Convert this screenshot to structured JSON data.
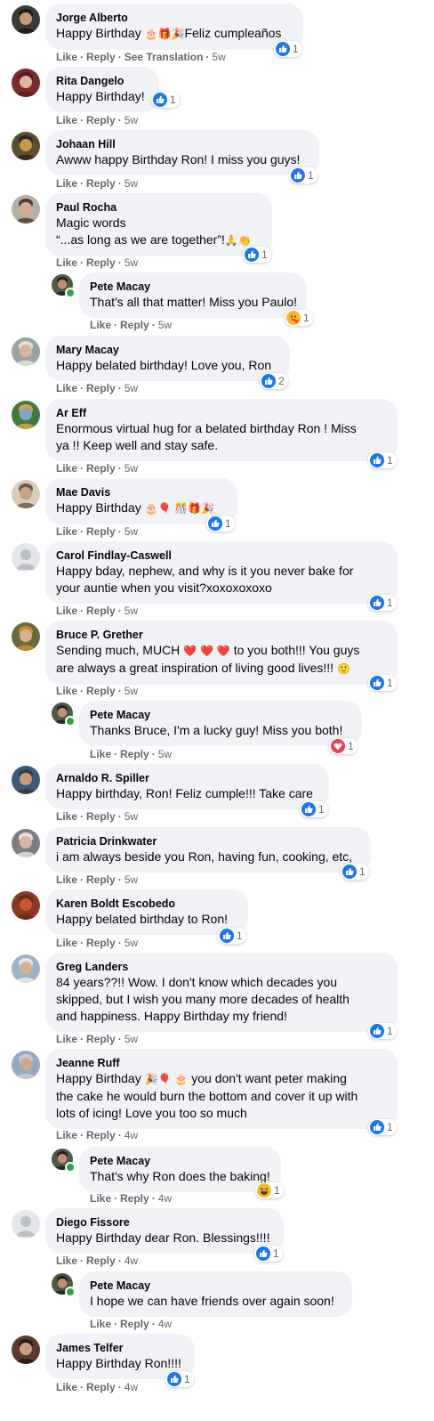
{
  "colors": {
    "like_blue": "#1877f2",
    "love_red": "#f33e58",
    "haha_yellow": "#f7b928",
    "bubble_bg": "#f0f2f5",
    "meta_gray": "#65676b"
  },
  "actions": {
    "like": "Like",
    "reply": "Reply",
    "see_translation": "See Translation",
    "sep": "·"
  },
  "comments": [
    {
      "author": "Jorge Alberto",
      "lines": [
        "Happy Birthday 🎂🎁🎉Feliz cumpleaños"
      ],
      "time": "5w",
      "translation": true,
      "reaction": {
        "icon": "like-icon",
        "count": "1"
      },
      "reply": false,
      "avatar": "avatar-jorge"
    },
    {
      "author": "Rita Dangelo",
      "lines": [
        "Happy Birthday!"
      ],
      "time": "5w",
      "reaction": {
        "icon": "like-icon",
        "count": "1"
      },
      "reply": false
    },
    {
      "author": "Johaan Hill",
      "lines": [
        "Awww happy Birthday Ron! I miss you guys!"
      ],
      "time": "5w",
      "reaction": {
        "icon": "like-icon",
        "count": "1"
      },
      "reply": false
    },
    {
      "author": "Paul Rocha",
      "lines": [
        "Magic words",
        "“...as long as we are together”!🙏👏"
      ],
      "time": "5w",
      "reaction": {
        "icon": "like-icon",
        "count": "1"
      },
      "reply": false
    },
    {
      "author": "Pete Macay",
      "lines": [
        "That's all that matter! Miss you Paulo!"
      ],
      "time": "5w",
      "reaction": {
        "icon": "care-icon",
        "count": "1"
      },
      "reply": true
    },
    {
      "author": "Mary Macay",
      "lines": [
        "Happy belated birthday! Love you, Ron"
      ],
      "time": "5w",
      "reaction": {
        "icon": "like-icon",
        "count": "2"
      },
      "reply": false
    },
    {
      "author": "Ar Eff",
      "lines": [
        "Enormous virtual hug for a belated birthday Ron ! Miss",
        "ya !! Keep well and stay safe."
      ],
      "time": "5w",
      "reaction": {
        "icon": "like-icon",
        "count": "1"
      },
      "reply": false
    },
    {
      "author": "Mae Davis",
      "lines": [
        "Happy Birthday 🎂🎈 🎊🎁🎉"
      ],
      "time": "5w",
      "reaction": {
        "icon": "like-icon",
        "count": "1"
      },
      "reply": false
    },
    {
      "author": "Carol Findlay-Caswell",
      "lines": [
        "Happy bday, nephew, and why is it you never bake for",
        "your auntie when you visit?xoxoxoxoxo"
      ],
      "time": "5w",
      "reaction": {
        "icon": "like-icon",
        "count": "1"
      },
      "reply": false
    },
    {
      "author": "Bruce P. Grether",
      "lines": [
        "Sending much, MUCH ❤️ ❤️ ❤️ to you both!!! You guys",
        "are always a great inspiration of living good lives!!! 🙂"
      ],
      "time": "5w",
      "reaction": {
        "icon": "like-icon",
        "count": "1"
      },
      "reply": false
    },
    {
      "author": "Pete Macay",
      "lines": [
        "Thanks Bruce, I'm a lucky guy! Miss you both!"
      ],
      "time": "5w",
      "reaction": {
        "icon": "love-icon",
        "count": "1"
      },
      "reply": true
    },
    {
      "author": "Arnaldo R. Spiller",
      "lines": [
        "Happy birthday, Ron! Feliz cumple!!! Take care"
      ],
      "time": "5w",
      "reaction": {
        "icon": "like-icon",
        "count": "1"
      },
      "reply": false
    },
    {
      "author": "Patricia Drinkwater",
      "lines": [
        "i am always beside you Ron, having fun, cooking, etc,"
      ],
      "time": "5w",
      "reaction": {
        "icon": "like-icon",
        "count": "1"
      },
      "reply": false
    },
    {
      "author": "Karen Boldt Escobedo",
      "lines": [
        "Happy belated birthday to Ron!"
      ],
      "time": "5w",
      "reaction": {
        "icon": "like-icon",
        "count": "1"
      },
      "reply": false
    },
    {
      "author": "Greg Landers",
      "lines": [
        "84 years??!! Wow. I don't know which decades you",
        "skipped, but I wish you many more decades of health",
        "and happiness. Happy Birthday my friend!"
      ],
      "time": "5w",
      "reaction": {
        "icon": "like-icon",
        "count": "1"
      },
      "reply": false
    },
    {
      "author": "Jeanne Ruff",
      "lines": [
        "Happy Birthday 🎉🎈 🎂 you don't want peter making",
        "the cake he would burn the bottom and cover it up with",
        "lots of icing! Love you too so much"
      ],
      "time": "4w",
      "reaction": {
        "icon": "like-icon",
        "count": "1"
      },
      "reply": false
    },
    {
      "author": "Pete Macay",
      "lines": [
        "That's why Ron does the baking!"
      ],
      "time": "4w",
      "reaction": {
        "icon": "haha-icon",
        "count": "1"
      },
      "reply": true
    },
    {
      "author": "Diego Fissore",
      "lines": [
        "Happy Birthday dear Ron. Blessings!!!!"
      ],
      "time": "4w",
      "reaction": {
        "icon": "like-icon",
        "count": "1"
      },
      "reply": false
    },
    {
      "author": "Pete Macay",
      "lines": [
        "I hope we can have friends over again soon!"
      ],
      "time": "4w",
      "reaction": null,
      "reply": true
    },
    {
      "author": "James Telfer",
      "lines": [
        "Happy Birthday Ron!!!!"
      ],
      "time": "4w",
      "reaction": {
        "icon": "like-icon",
        "count": "1"
      },
      "reply": false
    }
  ]
}
